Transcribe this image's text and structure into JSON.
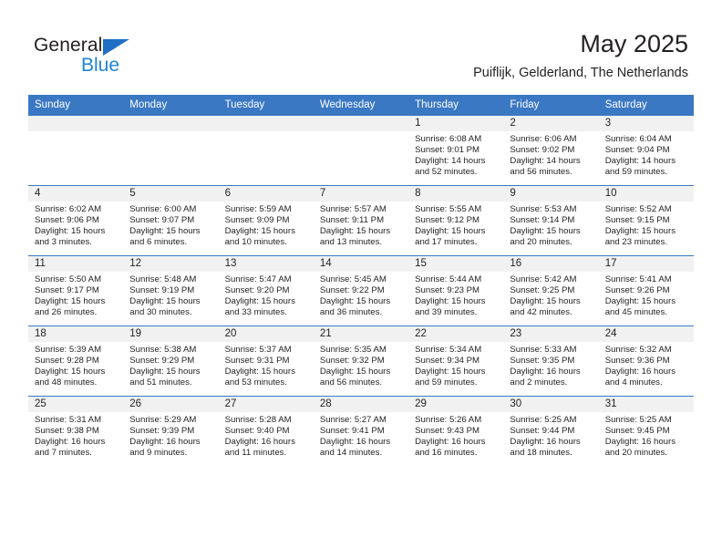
{
  "brand": {
    "line1": "General",
    "line2": "Blue",
    "logo_color": "#1f83d4"
  },
  "header": {
    "title": "May 2025",
    "subtitle": "Puiflijk, Gelderland, The Netherlands",
    "header_bg_color": "#3b78c3"
  },
  "calendar": {
    "weekdays": [
      "Sunday",
      "Monday",
      "Tuesday",
      "Wednesday",
      "Thursday",
      "Friday",
      "Saturday"
    ],
    "labels": {
      "sunrise": "Sunrise:",
      "sunset": "Sunset:",
      "daylight": "Daylight:"
    },
    "weeks": [
      [
        {
          "day": "",
          "sunrise": "",
          "sunset": "",
          "daylight_line1": "",
          "daylight_line2": ""
        },
        {
          "day": "",
          "sunrise": "",
          "sunset": "",
          "daylight_line1": "",
          "daylight_line2": ""
        },
        {
          "day": "",
          "sunrise": "",
          "sunset": "",
          "daylight_line1": "",
          "daylight_line2": ""
        },
        {
          "day": "",
          "sunrise": "",
          "sunset": "",
          "daylight_line1": "",
          "daylight_line2": ""
        },
        {
          "day": "1",
          "sunrise": "Sunrise: 6:08 AM",
          "sunset": "Sunset: 9:01 PM",
          "daylight_line1": "Daylight: 14 hours",
          "daylight_line2": "and 52 minutes."
        },
        {
          "day": "2",
          "sunrise": "Sunrise: 6:06 AM",
          "sunset": "Sunset: 9:02 PM",
          "daylight_line1": "Daylight: 14 hours",
          "daylight_line2": "and 56 minutes."
        },
        {
          "day": "3",
          "sunrise": "Sunrise: 6:04 AM",
          "sunset": "Sunset: 9:04 PM",
          "daylight_line1": "Daylight: 14 hours",
          "daylight_line2": "and 59 minutes."
        }
      ],
      [
        {
          "day": "4",
          "sunrise": "Sunrise: 6:02 AM",
          "sunset": "Sunset: 9:06 PM",
          "daylight_line1": "Daylight: 15 hours",
          "daylight_line2": "and 3 minutes."
        },
        {
          "day": "5",
          "sunrise": "Sunrise: 6:00 AM",
          "sunset": "Sunset: 9:07 PM",
          "daylight_line1": "Daylight: 15 hours",
          "daylight_line2": "and 6 minutes."
        },
        {
          "day": "6",
          "sunrise": "Sunrise: 5:59 AM",
          "sunset": "Sunset: 9:09 PM",
          "daylight_line1": "Daylight: 15 hours",
          "daylight_line2": "and 10 minutes."
        },
        {
          "day": "7",
          "sunrise": "Sunrise: 5:57 AM",
          "sunset": "Sunset: 9:11 PM",
          "daylight_line1": "Daylight: 15 hours",
          "daylight_line2": "and 13 minutes."
        },
        {
          "day": "8",
          "sunrise": "Sunrise: 5:55 AM",
          "sunset": "Sunset: 9:12 PM",
          "daylight_line1": "Daylight: 15 hours",
          "daylight_line2": "and 17 minutes."
        },
        {
          "day": "9",
          "sunrise": "Sunrise: 5:53 AM",
          "sunset": "Sunset: 9:14 PM",
          "daylight_line1": "Daylight: 15 hours",
          "daylight_line2": "and 20 minutes."
        },
        {
          "day": "10",
          "sunrise": "Sunrise: 5:52 AM",
          "sunset": "Sunset: 9:15 PM",
          "daylight_line1": "Daylight: 15 hours",
          "daylight_line2": "and 23 minutes."
        }
      ],
      [
        {
          "day": "11",
          "sunrise": "Sunrise: 5:50 AM",
          "sunset": "Sunset: 9:17 PM",
          "daylight_line1": "Daylight: 15 hours",
          "daylight_line2": "and 26 minutes."
        },
        {
          "day": "12",
          "sunrise": "Sunrise: 5:48 AM",
          "sunset": "Sunset: 9:19 PM",
          "daylight_line1": "Daylight: 15 hours",
          "daylight_line2": "and 30 minutes."
        },
        {
          "day": "13",
          "sunrise": "Sunrise: 5:47 AM",
          "sunset": "Sunset: 9:20 PM",
          "daylight_line1": "Daylight: 15 hours",
          "daylight_line2": "and 33 minutes."
        },
        {
          "day": "14",
          "sunrise": "Sunrise: 5:45 AM",
          "sunset": "Sunset: 9:22 PM",
          "daylight_line1": "Daylight: 15 hours",
          "daylight_line2": "and 36 minutes."
        },
        {
          "day": "15",
          "sunrise": "Sunrise: 5:44 AM",
          "sunset": "Sunset: 9:23 PM",
          "daylight_line1": "Daylight: 15 hours",
          "daylight_line2": "and 39 minutes."
        },
        {
          "day": "16",
          "sunrise": "Sunrise: 5:42 AM",
          "sunset": "Sunset: 9:25 PM",
          "daylight_line1": "Daylight: 15 hours",
          "daylight_line2": "and 42 minutes."
        },
        {
          "day": "17",
          "sunrise": "Sunrise: 5:41 AM",
          "sunset": "Sunset: 9:26 PM",
          "daylight_line1": "Daylight: 15 hours",
          "daylight_line2": "and 45 minutes."
        }
      ],
      [
        {
          "day": "18",
          "sunrise": "Sunrise: 5:39 AM",
          "sunset": "Sunset: 9:28 PM",
          "daylight_line1": "Daylight: 15 hours",
          "daylight_line2": "and 48 minutes."
        },
        {
          "day": "19",
          "sunrise": "Sunrise: 5:38 AM",
          "sunset": "Sunset: 9:29 PM",
          "daylight_line1": "Daylight: 15 hours",
          "daylight_line2": "and 51 minutes."
        },
        {
          "day": "20",
          "sunrise": "Sunrise: 5:37 AM",
          "sunset": "Sunset: 9:31 PM",
          "daylight_line1": "Daylight: 15 hours",
          "daylight_line2": "and 53 minutes."
        },
        {
          "day": "21",
          "sunrise": "Sunrise: 5:35 AM",
          "sunset": "Sunset: 9:32 PM",
          "daylight_line1": "Daylight: 15 hours",
          "daylight_line2": "and 56 minutes."
        },
        {
          "day": "22",
          "sunrise": "Sunrise: 5:34 AM",
          "sunset": "Sunset: 9:34 PM",
          "daylight_line1": "Daylight: 15 hours",
          "daylight_line2": "and 59 minutes."
        },
        {
          "day": "23",
          "sunrise": "Sunrise: 5:33 AM",
          "sunset": "Sunset: 9:35 PM",
          "daylight_line1": "Daylight: 16 hours",
          "daylight_line2": "and 2 minutes."
        },
        {
          "day": "24",
          "sunrise": "Sunrise: 5:32 AM",
          "sunset": "Sunset: 9:36 PM",
          "daylight_line1": "Daylight: 16 hours",
          "daylight_line2": "and 4 minutes."
        }
      ],
      [
        {
          "day": "25",
          "sunrise": "Sunrise: 5:31 AM",
          "sunset": "Sunset: 9:38 PM",
          "daylight_line1": "Daylight: 16 hours",
          "daylight_line2": "and 7 minutes."
        },
        {
          "day": "26",
          "sunrise": "Sunrise: 5:29 AM",
          "sunset": "Sunset: 9:39 PM",
          "daylight_line1": "Daylight: 16 hours",
          "daylight_line2": "and 9 minutes."
        },
        {
          "day": "27",
          "sunrise": "Sunrise: 5:28 AM",
          "sunset": "Sunset: 9:40 PM",
          "daylight_line1": "Daylight: 16 hours",
          "daylight_line2": "and 11 minutes."
        },
        {
          "day": "28",
          "sunrise": "Sunrise: 5:27 AM",
          "sunset": "Sunset: 9:41 PM",
          "daylight_line1": "Daylight: 16 hours",
          "daylight_line2": "and 14 minutes."
        },
        {
          "day": "29",
          "sunrise": "Sunrise: 5:26 AM",
          "sunset": "Sunset: 9:43 PM",
          "daylight_line1": "Daylight: 16 hours",
          "daylight_line2": "and 16 minutes."
        },
        {
          "day": "30",
          "sunrise": "Sunrise: 5:25 AM",
          "sunset": "Sunset: 9:44 PM",
          "daylight_line1": "Daylight: 16 hours",
          "daylight_line2": "and 18 minutes."
        },
        {
          "day": "31",
          "sunrise": "Sunrise: 5:25 AM",
          "sunset": "Sunset: 9:45 PM",
          "daylight_line1": "Daylight: 16 hours",
          "daylight_line2": "and 20 minutes."
        }
      ]
    ]
  }
}
